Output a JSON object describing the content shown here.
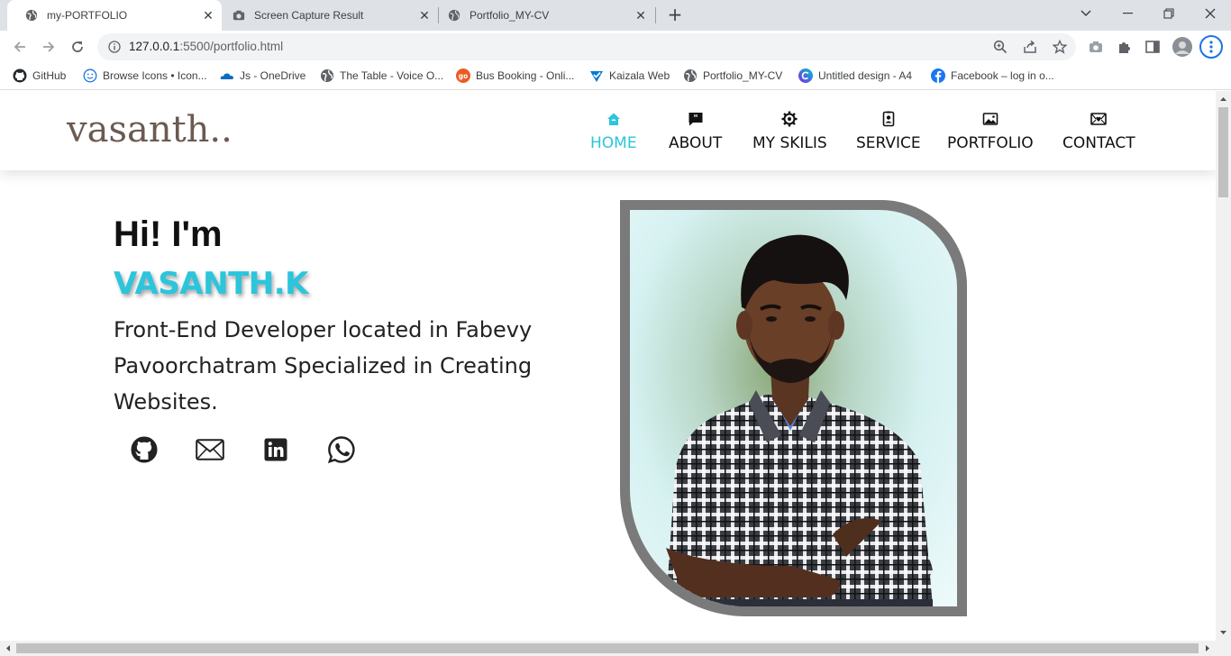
{
  "browser": {
    "tabs": [
      {
        "title": "my-PORTFOLIO",
        "active": true,
        "icon": "globe-icon"
      },
      {
        "title": "Screen Capture Result",
        "active": false,
        "icon": "camera-icon"
      },
      {
        "title": "Portfolio_MY-CV",
        "active": false,
        "icon": "globe-icon"
      }
    ],
    "url_host": "127.0.0.1",
    "url_path": ":5500/portfolio.html",
    "bookmarks": [
      {
        "label": "GitHub",
        "icon": "github-icon"
      },
      {
        "label": "Browse Icons • Icon...",
        "icon": "smiley-icon"
      },
      {
        "label": "Js - OneDrive",
        "icon": "onedrive-icon"
      },
      {
        "label": "The Table - Voice O...",
        "icon": "globe-icon"
      },
      {
        "label": "Bus Booking - Onli...",
        "icon": "goibibo-icon"
      },
      {
        "label": "Kaizala Web",
        "icon": "kaizala-icon"
      },
      {
        "label": "Portfolio_MY-CV",
        "icon": "globe-icon"
      },
      {
        "label": "Untitled design - A4",
        "icon": "canva-icon"
      },
      {
        "label": "Facebook – log in o...",
        "icon": "facebook-icon"
      }
    ]
  },
  "site": {
    "logo": "vasanth..",
    "nav": [
      {
        "label": "HOME",
        "icon": "home-icon",
        "active": true
      },
      {
        "label": "ABOUT",
        "icon": "quote-chat-icon",
        "active": false
      },
      {
        "label": "MY SKILIS",
        "icon": "gear-icon",
        "active": false
      },
      {
        "label": "SERVICE",
        "icon": "id-badge-icon",
        "active": false
      },
      {
        "label": "PORTFOLIO",
        "icon": "image-icon",
        "active": false
      },
      {
        "label": "CONTACT",
        "icon": "envelope-heart-icon",
        "active": false
      }
    ],
    "hero": {
      "greeting": "Hi! I'm",
      "name": "VASANTH.K",
      "description": "Front-End Developer located in Fabevy Pavoorchatram Specialized in Creating Websites."
    },
    "social": [
      "github-icon",
      "mail-icon",
      "linkedin-icon",
      "whatsapp-icon"
    ]
  },
  "colors": {
    "accent": "#2bc5dc",
    "logo": "#6b5a52",
    "frame": "#7a7a7a"
  }
}
